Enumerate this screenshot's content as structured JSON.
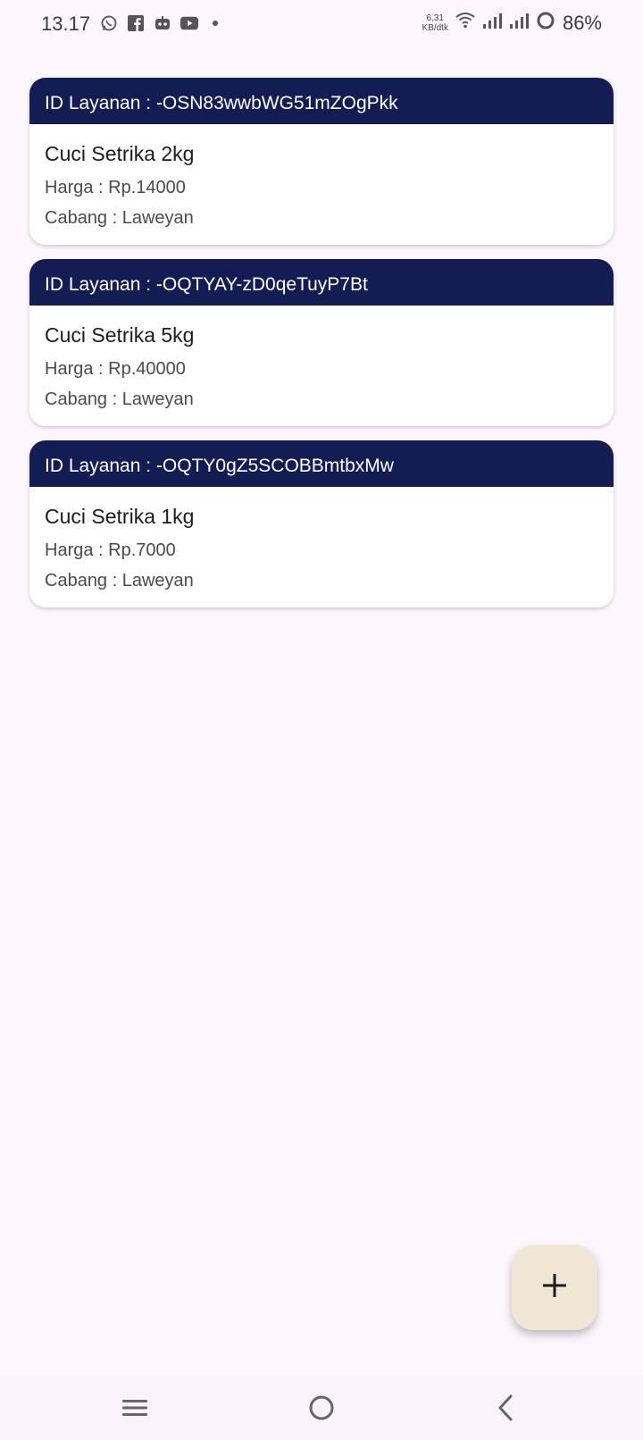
{
  "status_bar": {
    "time": "13.17",
    "icons": [
      "whatsapp-icon",
      "facebook-icon",
      "robot-app-icon",
      "youtube-icon"
    ],
    "net_speed_value": "6,31",
    "net_speed_unit": "KB/dtk",
    "battery": "86%"
  },
  "services": [
    {
      "id_label": "ID Layanan : -OSN83wwbWG51mZOgPkk",
      "name": "Cuci Setrika 2kg",
      "price": "Harga : Rp.14000",
      "branch": "Cabang : Laweyan"
    },
    {
      "id_label": "ID Layanan : -OQTYAY-zD0qeTuyP7Bt",
      "name": "Cuci Setrika 5kg",
      "price": "Harga : Rp.40000",
      "branch": "Cabang : Laweyan"
    },
    {
      "id_label": "ID Layanan : -OQTY0gZ5SCOBBmtbxMw",
      "name": "Cuci Setrika 1kg",
      "price": "Harga : Rp.7000",
      "branch": "Cabang : Laweyan"
    }
  ],
  "fab": {
    "icon": "plus-icon"
  },
  "nav": {
    "items": [
      "menu-icon",
      "home-icon",
      "back-icon"
    ]
  },
  "colors": {
    "background": "#fdf6fd",
    "card_header": "#141c54",
    "fab": "#f0e6d6"
  }
}
